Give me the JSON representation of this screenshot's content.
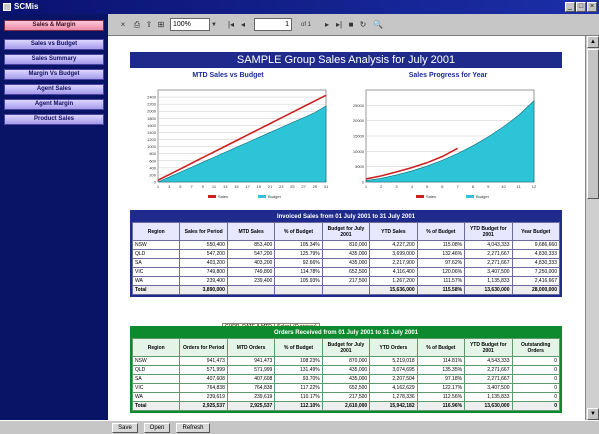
{
  "window": {
    "title": "SCMis"
  },
  "sidebar": {
    "items": [
      {
        "label": "Sales & Margin",
        "active": true
      },
      {
        "label": "Sales vs Budget",
        "active": false
      },
      {
        "label": "Sales Summary",
        "active": false
      },
      {
        "label": "Margin Vs Budget",
        "active": false
      },
      {
        "label": "Agent Sales",
        "active": false
      },
      {
        "label": "Agent Margin",
        "active": false
      },
      {
        "label": "Product Sales",
        "active": false
      }
    ]
  },
  "toolbar": {
    "zoom": "100%",
    "page": "1",
    "page_of": "of 1",
    "icons": [
      "close-icon",
      "print-icon",
      "export-icon",
      "tree-icon",
      "first-page-icon",
      "prev-page-icon",
      "next-page-icon",
      "last-page-icon",
      "stop-icon",
      "refresh-icon",
      "search-icon"
    ]
  },
  "report": {
    "title": "SAMPLE Group Sales Analysis for July 2001"
  },
  "chart_data": [
    {
      "type": "area",
      "title": "MTD Sales vs Budget",
      "x": [
        1,
        3,
        5,
        7,
        9,
        11,
        13,
        15,
        17,
        19,
        21,
        23,
        25,
        27,
        29,
        31
      ],
      "ylim": [
        0,
        2600
      ],
      "yticks": [
        0,
        200,
        400,
        600,
        800,
        1000,
        1200,
        1400,
        1600,
        1800,
        2000,
        2200,
        2400
      ],
      "series": [
        {
          "name": "Sales",
          "kind": "line",
          "color": "#cc2020",
          "values": [
            50,
            210,
            370,
            530,
            690,
            850,
            1010,
            1170,
            1330,
            1490,
            1650,
            1810,
            1970,
            2130,
            2290,
            2450
          ]
        },
        {
          "name": "Budget",
          "kind": "area",
          "color": "#2ec4d8",
          "values": [
            0,
            140,
            280,
            420,
            560,
            700,
            840,
            980,
            1120,
            1260,
            1400,
            1540,
            1680,
            1820,
            1960,
            2150
          ]
        }
      ]
    },
    {
      "type": "area",
      "title": "Sales Progress for Year",
      "x": [
        1,
        2,
        3,
        4,
        5,
        6,
        7,
        8,
        9,
        10,
        11,
        12
      ],
      "ylim": [
        0,
        30000
      ],
      "yticks": [
        0,
        5000,
        10000,
        15000,
        20000,
        25000
      ],
      "series": [
        {
          "name": "Sales",
          "kind": "line",
          "color": "#cc2020",
          "values": [
            1000,
            2000,
            3300,
            4700,
            6300,
            8300,
            11000,
            null,
            null,
            null,
            null,
            null
          ]
        },
        {
          "name": "Budget",
          "kind": "area",
          "color": "#2ec4d8",
          "values": [
            500,
            1200,
            2300,
            3600,
            5200,
            7100,
            9300,
            11800,
            14700,
            18000,
            21800,
            26500
          ]
        }
      ]
    }
  ],
  "invoiced": {
    "title": "Invoiced Sales from 01 July 2001 to 31 July 2001",
    "headers": [
      "Region",
      "Sales for Period",
      "MTD Sales",
      "% of Budget",
      "Budget for July 2001",
      "YTD Sales",
      "% of Budget",
      "YTD Budget for 2001",
      "Year Budget"
    ],
    "rows": [
      [
        "NSW",
        "550,400",
        "853,400",
        "105.34%",
        "810,000",
        "4,227,200",
        "115.08%",
        "4,043,333",
        "9,686,660"
      ],
      [
        "QLD",
        "547,200",
        "547,200",
        "125.79%",
        "435,000",
        "3,699,000",
        "132.46%",
        "2,271,667",
        "4,830,333"
      ],
      [
        "SA",
        "403,200",
        "403,200",
        "92.66%",
        "435,000",
        "2,217,900",
        "97.62%",
        "2,271,667",
        "4,830,333"
      ],
      [
        "VIC",
        "749,800",
        "749,800",
        "114.78%",
        "652,500",
        "4,116,400",
        "120.06%",
        "3,407,500",
        "7,250,000"
      ],
      [
        "WA",
        "239,400",
        "239,400",
        "105.93%",
        "217,500",
        "1,267,200",
        "111.57%",
        "1,135,833",
        "2,416,667"
      ]
    ],
    "total": [
      "Total",
      "3,890,000",
      "",
      "",
      "",
      "15,636,000",
      "115.58%",
      "13,630,000",
      "28,000,000"
    ],
    "tags": [
      "CURR_DATE",
      "MTD",
      "Sales",
      "(Currency)"
    ]
  },
  "orders": {
    "title": "Orders Received from 01 July 2001 to 31 July 2001",
    "headers": [
      "Region",
      "Orders for Period",
      "MTD Orders",
      "% of Budget",
      "Budget for July 2001",
      "YTD Orders",
      "% of Budget",
      "YTD Budget for 2001",
      "Outstanding Orders"
    ],
    "rows": [
      [
        "NSW",
        "941,473",
        "941,473",
        "108.23%",
        "870,000",
        "5,219,018",
        "114.81%",
        "4,543,333",
        "0"
      ],
      [
        "QLD",
        "571,999",
        "571,999",
        "131.49%",
        "435,000",
        "3,074,695",
        "135.35%",
        "2,271,667",
        "0"
      ],
      [
        "SA",
        "407,608",
        "407,608",
        "93.70%",
        "435,000",
        "2,207,504",
        "97.18%",
        "2,271,667",
        "0"
      ],
      [
        "VIC",
        "764,838",
        "764,838",
        "117.22%",
        "652,500",
        "4,162,629",
        "122.17%",
        "3,407,500",
        "0"
      ],
      [
        "WA",
        "239,619",
        "239,619",
        "110.17%",
        "217,500",
        "1,278,336",
        "112.56%",
        "1,135,833",
        "0"
      ]
    ],
    "total": [
      "Total",
      "2,925,537",
      "2,925,537",
      "112.10%",
      "2,610,000",
      "15,942,182",
      "116.96%",
      "13,630,000",
      "0"
    ]
  },
  "bottom": {
    "buttons": [
      "Save",
      "Open",
      "Refresh"
    ]
  }
}
